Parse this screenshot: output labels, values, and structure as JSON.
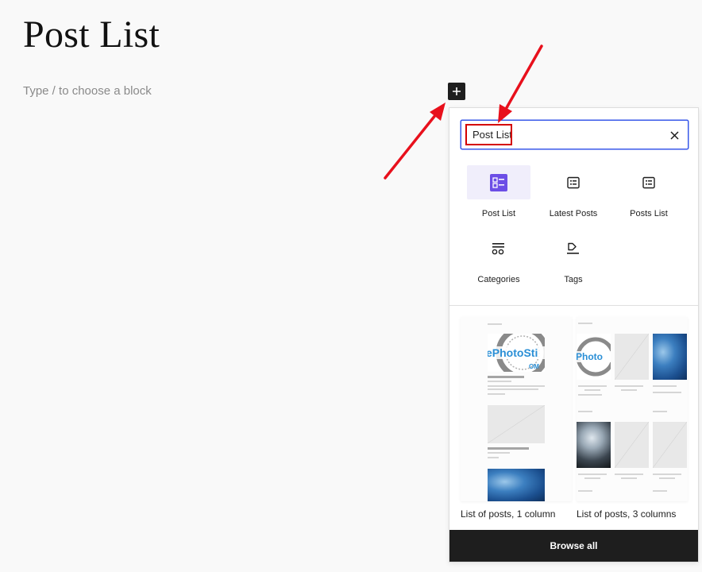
{
  "page": {
    "title": "Post List",
    "placeholder": "Type / to choose a block"
  },
  "inserter": {
    "search_value": "Post List",
    "blocks": [
      {
        "label": "Post List",
        "icon": "post-list-icon",
        "active": true
      },
      {
        "label": "Latest Posts",
        "icon": "latest-posts-icon",
        "active": false
      },
      {
        "label": "Posts List",
        "icon": "posts-list-icon",
        "active": false
      },
      {
        "label": "Categories",
        "icon": "categories-icon",
        "active": false
      },
      {
        "label": "Tags",
        "icon": "tags-icon",
        "active": false
      }
    ],
    "patterns": [
      {
        "label": "List of posts, 1 column"
      },
      {
        "label": "List of posts, 3 columns"
      }
    ],
    "browse_all": "Browse all"
  },
  "colors": {
    "accent": "#3858e9",
    "block_icon_active": "#6c4ee6",
    "annotation": "#e8101c",
    "dark": "#1e1e1e"
  }
}
